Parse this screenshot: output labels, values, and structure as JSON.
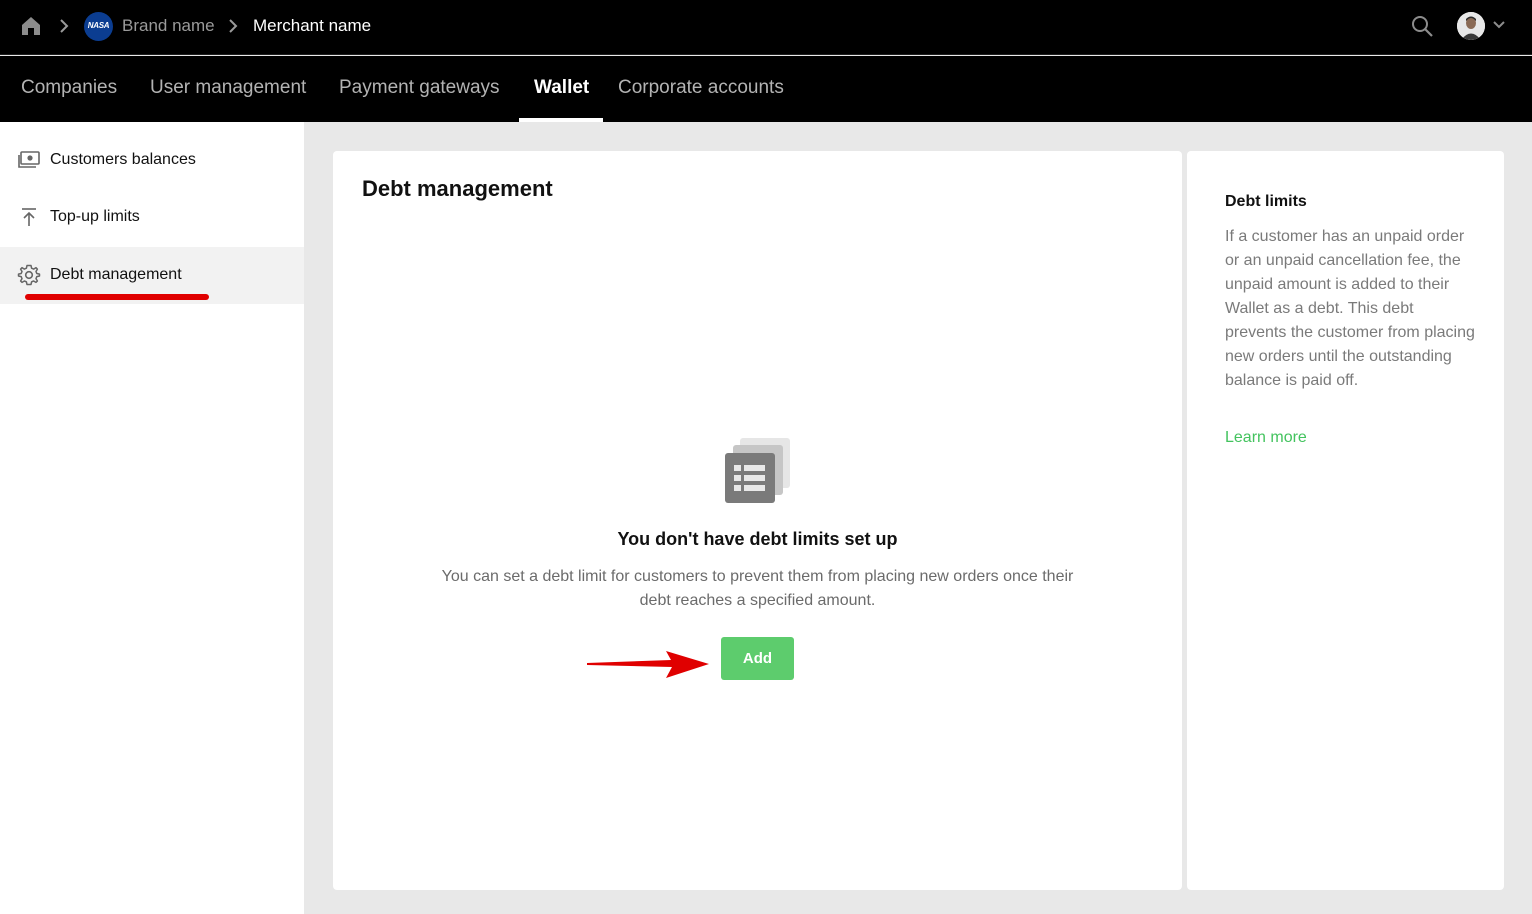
{
  "header": {
    "breadcrumb": {
      "brand_logo_text": "NASA",
      "brand_name": "Brand name",
      "merchant_name": "Merchant name"
    },
    "icons": [
      "home-icon",
      "chevron-right-icon",
      "search-icon",
      "avatar",
      "chevron-down-icon"
    ]
  },
  "nav": {
    "tabs": [
      {
        "label": "Companies",
        "active": false
      },
      {
        "label": "User management",
        "active": false
      },
      {
        "label": "Payment gateways",
        "active": false
      },
      {
        "label": "Wallet",
        "active": true
      },
      {
        "label": "Corporate accounts",
        "active": false
      }
    ]
  },
  "sidebar": {
    "items": [
      {
        "label": "Customers balances",
        "icon": "cash-icon",
        "active": false
      },
      {
        "label": "Top-up limits",
        "icon": "upload-arrow-icon",
        "active": false
      },
      {
        "label": "Debt management",
        "icon": "gear-icon",
        "active": true
      }
    ]
  },
  "main": {
    "title": "Debt management",
    "empty_state": {
      "icon": "list-document-icon",
      "title": "You don't have debt limits set up",
      "description": "You can set a debt limit for customers to prevent them from placing new orders once their debt reaches a specified amount.",
      "button_label": "Add"
    }
  },
  "info": {
    "title": "Debt limits",
    "text": "If a customer has an unpaid order or an unpaid cancellation fee, the unpaid amount is added to their Wallet as a debt. This debt prevents the customer from placing new orders until the outstanding balance is paid off.",
    "link_label": "Learn more"
  },
  "colors": {
    "accent_green": "#5dcc6d",
    "link_green": "#43c35e",
    "annotation_red": "#e00000",
    "header_bg": "#000000"
  }
}
